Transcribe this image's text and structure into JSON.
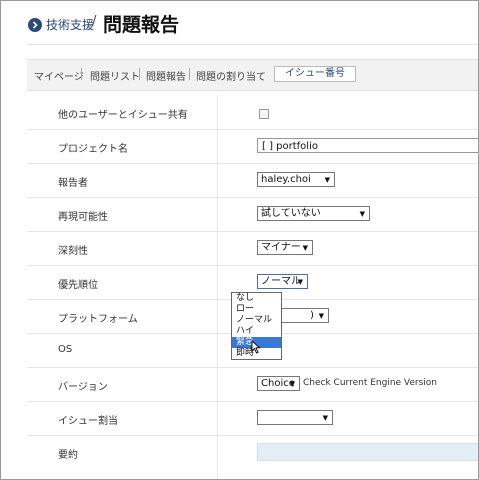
{
  "header": {
    "breadcrumb": "技術支援",
    "separator": "/",
    "title": "問題報告"
  },
  "nav": {
    "items": [
      "マイページ",
      "問題リスト",
      "問題報告",
      "問題の割り当て"
    ],
    "issue_placeholder": "イシュー番号"
  },
  "form": {
    "share_label": "他のユーザーとイシュー共有",
    "project_label": "プロジェクト名",
    "project_value": "[ ] portfolio",
    "reporter_label": "報告者",
    "reporter_value": "haley.choi",
    "reproducibility_label": "再現可能性",
    "reproducibility_value": "試していない",
    "severity_label": "深刻性",
    "severity_value": "マイナー",
    "priority_label": "優先順位",
    "priority_value": "ノーマル",
    "priority_options": [
      "なし",
      "ロー",
      "ノーマル",
      "ハイ",
      "緊急",
      "即時"
    ],
    "priority_highlighted": "緊急",
    "platform_label": "プラットフォーム",
    "platform_value_visible": ")",
    "os_label": "OS",
    "version_label": "バージョン",
    "version_value": "Choice",
    "version_note": "Check Current Engine Version",
    "assign_label": "イシュー割当",
    "assign_value": "",
    "summary_label": "要約"
  },
  "colors": {
    "accent": "#2a4a7a",
    "highlight": "#3b77d4",
    "summary_bg": "#e4eef7"
  }
}
